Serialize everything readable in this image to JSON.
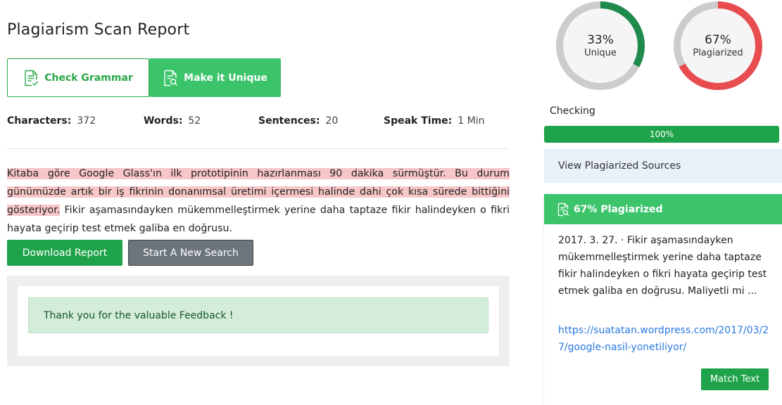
{
  "title": "Plagiarism Scan Report",
  "buttons": {
    "check_grammar": "Check Grammar",
    "make_unique": "Make it Unique",
    "download": "Download Report",
    "new_search": "Start A New Search",
    "match_text": "Match Text"
  },
  "stats": {
    "characters_label": "Characters:",
    "characters_value": "372",
    "words_label": "Words:",
    "words_value": "52",
    "sentences_label": "Sentences:",
    "sentences_value": "20",
    "speak_label": "Speak Time:",
    "speak_value": "1 Min"
  },
  "text": {
    "highlighted": " Kitaba göre Google Glass'ın ilk prototipinin hazırlanması 90 dakika sürmüştür. Bu durum günümüzde artık bir iş fikrinin donanımsal üretimi içermesi halinde dahi çok kısa sürede bittiğini gösteriyor.",
    "normal": " Fikir aşamasındayken mükemmelleştirmek yerine daha taptaze fikir halindeyken o fikri hayata geçirip test etmek galiba en doğrusu."
  },
  "feedback": "Thank you for the valuable Feedback !",
  "gauges": {
    "unique_pct": "33%",
    "unique_label": "Unique",
    "unique_value": 33,
    "plag_pct": "67%",
    "plag_label": "Plagiarized",
    "plag_value": 67
  },
  "checking": {
    "label": "Checking",
    "progress_text": "100%",
    "progress_value": 100
  },
  "view_sources": "View Plagiarized Sources",
  "result": {
    "header": "67% Plagiarized",
    "snippet": "2017. 3. 27. · Fikir aşamasındayken mükemmelleştirmek yerine daha taptaze fikir halindeyken o fikri hayata geçirip test etmek galiba en doğrusu. Maliyetli mi ...",
    "link": "https://suatatan.wordpress.com/2017/03/27/google-nasil-yonetiliyor/"
  },
  "colors": {
    "green": "#1fa34a",
    "light_green": "#3cc46b",
    "unique_arc": "#1e8a4c",
    "plag_arc": "#e84c4f",
    "gauge_track": "#cccccc",
    "highlight": "#f7c6c9"
  }
}
